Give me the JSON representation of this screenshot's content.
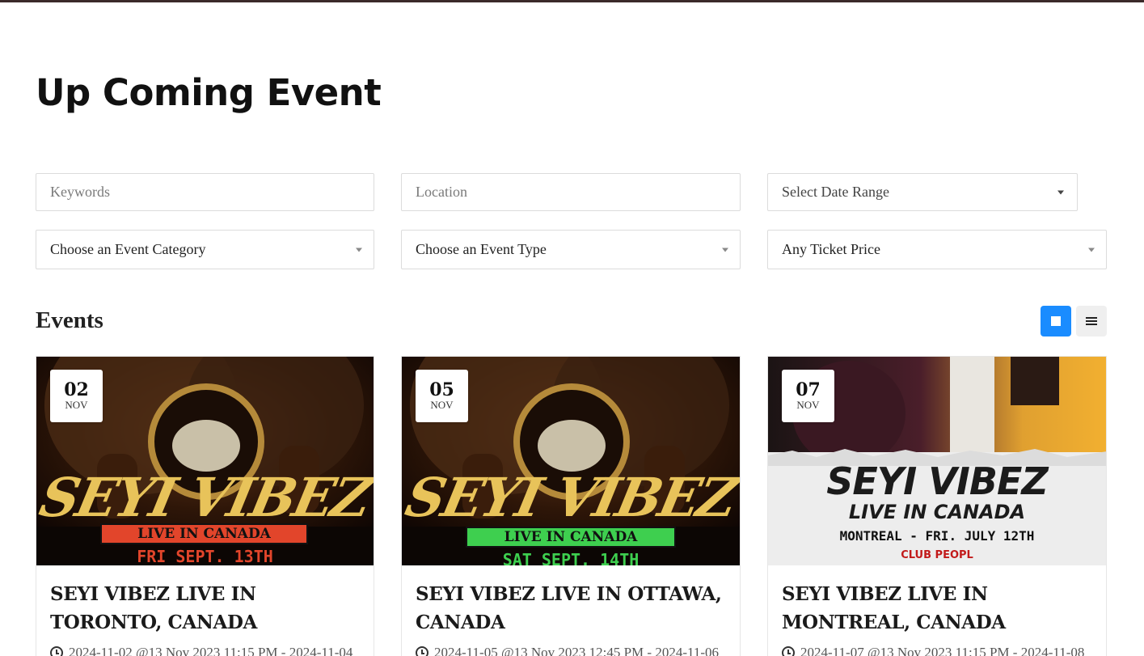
{
  "page": {
    "title": "Up Coming Event"
  },
  "filters": {
    "keywords_placeholder": "Keywords",
    "location_placeholder": "Location",
    "date_range": "Select Date Range",
    "category": "Choose an Event Category",
    "type": "Choose an Event Type",
    "price": "Any Ticket Price"
  },
  "events_section": {
    "title": "Events",
    "grid_icon": "grid-view-icon",
    "list_icon": "list-view-icon",
    "active_view": "grid"
  },
  "events": [
    {
      "day": "02",
      "month": "NOV",
      "title": "SEYI VIBEZ LIVE IN TORONTO, CANADA",
      "time": "2024-11-02 @13 Nov 2023 11:15 PM - 2024-11-04",
      "poster": {
        "headline": "SEYI VIBEZ",
        "banner": "LIVE IN CANADA",
        "date": "FRI SEPT. 13TH",
        "banner_color": "#e2452b",
        "date_color": "#e2452b"
      }
    },
    {
      "day": "05",
      "month": "NOV",
      "title": "SEYI VIBEZ LIVE IN OTTAWA, CANADA",
      "time": "2024-11-05 @13 Nov 2023 12:45 PM - 2024-11-06",
      "poster": {
        "headline": "SEYI VIBEZ",
        "banner": "LIVE IN CANADA",
        "date": "SAT SEPT. 14TH",
        "banner_color": "#3ecf4f",
        "date_color": "#3ecf4f"
      }
    },
    {
      "day": "07",
      "month": "NOV",
      "title": "SEYI VIBEZ LIVE IN MONTREAL, CANADA",
      "time": "2024-11-07 @13 Nov 2023 11:15 PM - 2024-11-08",
      "poster": {
        "headline": "SEYI VIBEZ",
        "subhead": "LIVE IN CANADA",
        "date": "MONTREAL - FRI. JULY 12TH",
        "venue": "CLUB PEOPL"
      }
    }
  ],
  "colors": {
    "accent": "#1a8cff",
    "top_bar": "#3b2a2a",
    "poster_gold": "#e8c35a"
  }
}
